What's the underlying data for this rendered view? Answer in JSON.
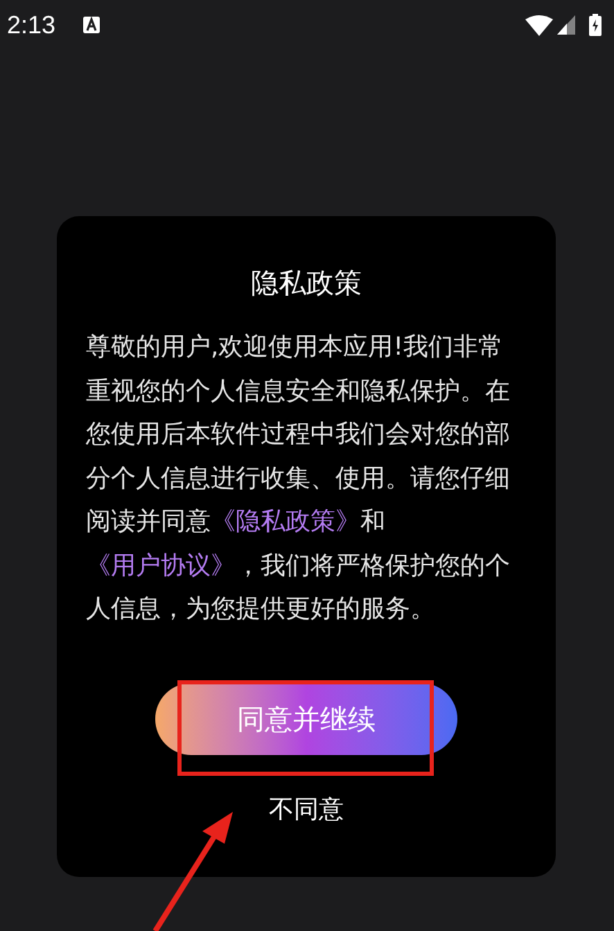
{
  "status_bar": {
    "time": "2:13"
  },
  "dialog": {
    "title": "隐私政策",
    "body": [
      {
        "kind": "text",
        "text": "尊敬的用户,欢迎使用本应用!我们非常重视您的个人信息安全和隐私保护。在您使用后本软件过程中我们会对您的部分个人信息进行收集、使用。请您仔细阅读并同意"
      },
      {
        "kind": "link",
        "text": "《隐私政策》"
      },
      {
        "kind": "text",
        "text": "和"
      },
      {
        "kind": "link",
        "text": "《用户协议》"
      },
      {
        "kind": "text",
        "text": "，我们将严格保护您的个人信息，为您提供更好的服务。"
      }
    ],
    "agree_button": "同意并继续",
    "decline_button": "不同意"
  }
}
